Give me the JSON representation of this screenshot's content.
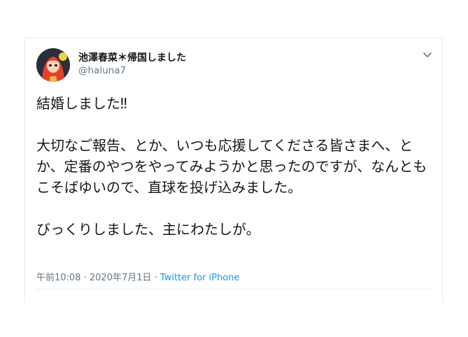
{
  "tweet": {
    "display_name": "池澤春菜＊帰国しました",
    "handle": "@haluna7",
    "text": "結婚しました‼︎\n\n大切なご報告、とか、いつも応援してくださる皆さまへ、とか、定番のやつをやってみようかと思ったのですが、なんともこそばゆいので、直球を投げ込みました。\n\nびっくりしました、主にわたしが。",
    "timestamp": "午前10:08 · 2020年7月1日",
    "separator": " · ",
    "source": "Twitter for iPhone"
  },
  "icons": {
    "caret": "chevron-down-icon",
    "avatar": "profile-avatar"
  }
}
